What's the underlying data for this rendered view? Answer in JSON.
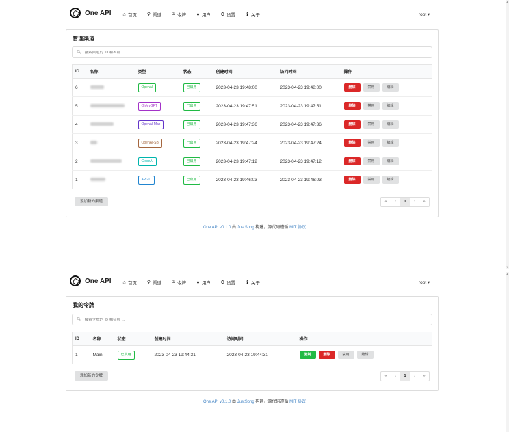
{
  "nav": {
    "brand": "One API",
    "items": [
      {
        "icon": "home-icon",
        "glyph": "⌂",
        "label": "首页"
      },
      {
        "icon": "sitemap-icon",
        "glyph": "⚲",
        "label": "渠道"
      },
      {
        "icon": "key-icon",
        "glyph": "⚿",
        "label": "令牌"
      },
      {
        "icon": "user-icon",
        "glyph": "●",
        "label": "用户"
      },
      {
        "icon": "gear-icon",
        "glyph": "⚙",
        "label": "设置"
      },
      {
        "icon": "info-icon",
        "glyph": "ℹ",
        "label": "关于"
      }
    ],
    "user": "root ▾"
  },
  "channels": {
    "title": "管理渠道",
    "search_placeholder": "搜索渠道的 ID 和名称 ...",
    "headers": [
      "ID",
      "名称",
      "类型",
      "状态",
      "创建时间",
      "访问时间",
      "操作"
    ],
    "rows": [
      {
        "id": "6",
        "type": "OpenAI",
        "type_color": "#21ba45",
        "status": "已启用",
        "created": "2023-04-23 19:48:00",
        "accessed": "2023-04-23 19:48:00"
      },
      {
        "id": "5",
        "type": "OhMyGPT",
        "type_color": "#a333c8",
        "status": "已启用",
        "created": "2023-04-23 19:47:51",
        "accessed": "2023-04-23 19:47:51"
      },
      {
        "id": "4",
        "type": "OpenAI Max",
        "type_color": "#6435c9",
        "status": "已启用",
        "created": "2023-04-23 19:47:36",
        "accessed": "2023-04-23 19:47:36"
      },
      {
        "id": "3",
        "type": "OpenAI-SB",
        "type_color": "#a5673f",
        "status": "已启用",
        "created": "2023-04-23 19:47:24",
        "accessed": "2023-04-23 19:47:24"
      },
      {
        "id": "2",
        "type": "CloseAI",
        "type_color": "#00b5ad",
        "status": "已启用",
        "created": "2023-04-23 19:47:12",
        "accessed": "2023-04-23 19:47:12"
      },
      {
        "id": "1",
        "type": "API2D",
        "type_color": "#2185d0",
        "status": "已启用",
        "created": "2023-04-23 19:46:03",
        "accessed": "2023-04-23 19:46:03"
      }
    ],
    "actions": {
      "delete": "删除",
      "disable": "禁用",
      "edit": "编辑"
    },
    "add_label": "添加新的渠道",
    "pager": [
      "«",
      "‹",
      "1",
      "›",
      "»"
    ]
  },
  "tokens": {
    "title": "我的令牌",
    "search_placeholder": "搜索令牌的 ID 和名称 ...",
    "headers": [
      "ID",
      "名称",
      "状态",
      "创建时间",
      "访问时间",
      "操作"
    ],
    "rows": [
      {
        "id": "1",
        "name": "Main",
        "status": "已启用",
        "created": "2023-04-23 19:44:31",
        "accessed": "2023-04-23 19:44:31"
      }
    ],
    "actions": {
      "copy": "复制",
      "delete": "删除",
      "disable": "禁用",
      "edit": "编辑"
    },
    "add_label": "添加新的令牌",
    "pager": [
      "«",
      "‹",
      "1",
      "›",
      "»"
    ]
  },
  "footer": {
    "app": "One API v0.1.0",
    "by": "由",
    "author": "JustSong",
    "mid": "构建，源代码遵循",
    "license": "MIT 协议"
  },
  "colors": {
    "delete": "#db2828",
    "copy": "#21ba45",
    "status_green": "#21ba45",
    "link": "#4183c4"
  }
}
